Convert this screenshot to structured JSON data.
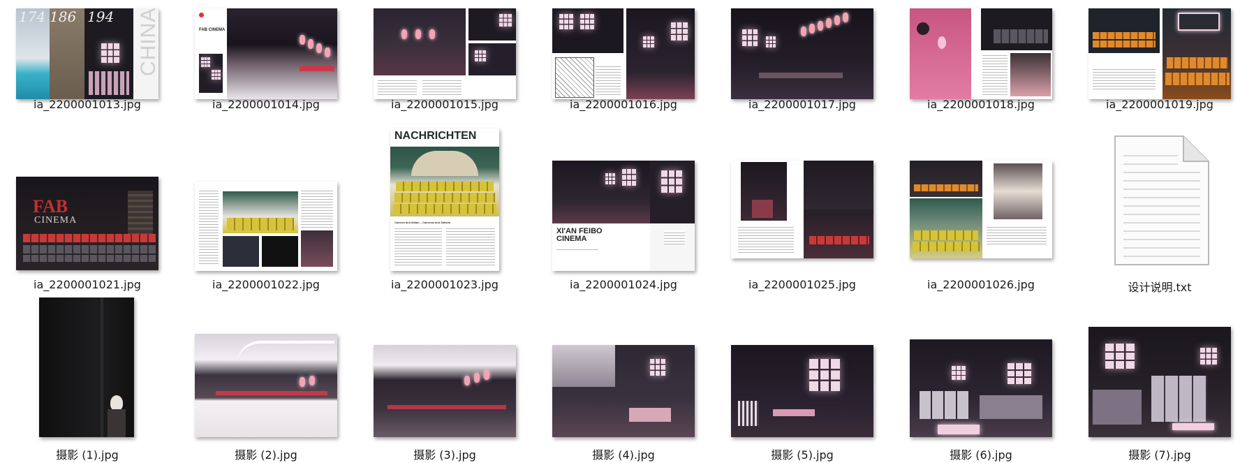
{
  "files": [
    {
      "name": "ia_2200001013.jpg",
      "icon": "image-thumbnail-icon",
      "cover_numbers": [
        "174",
        "186",
        "194"
      ],
      "cover_word": "CHINA"
    },
    {
      "name": "ia_2200001014.jpg",
      "icon": "image-thumbnail-icon",
      "page_heading": "FAB CINEMA"
    },
    {
      "name": "ia_2200001015.jpg",
      "icon": "image-thumbnail-icon"
    },
    {
      "name": "ia_2200001016.jpg",
      "icon": "image-thumbnail-icon"
    },
    {
      "name": "ia_2200001017.jpg",
      "icon": "image-thumbnail-icon"
    },
    {
      "name": "ia_2200001018.jpg",
      "icon": "image-thumbnail-icon"
    },
    {
      "name": "ia_2200001019.jpg",
      "icon": "image-thumbnail-icon"
    },
    {
      "name": "ia_2200001021.jpg",
      "icon": "image-thumbnail-icon",
      "title_top": "FAB",
      "title_bottom": "CINEMA"
    },
    {
      "name": "ia_2200001022.jpg",
      "icon": "image-thumbnail-icon"
    },
    {
      "name": "ia_2200001023.jpg",
      "icon": "image-thumbnail-icon",
      "headline": "NACHRICHTEN",
      "subhead": "Camera and Italian – Cameras and Saltwin"
    },
    {
      "name": "ia_2200001024.jpg",
      "icon": "image-thumbnail-icon",
      "title_top": "XI'AN FEIBO",
      "title_bottom": "CINEMA"
    },
    {
      "name": "ia_2200001025.jpg",
      "icon": "image-thumbnail-icon"
    },
    {
      "name": "ia_2200001026.jpg",
      "icon": "image-thumbnail-icon"
    },
    {
      "name": "设计说明.txt",
      "icon": "text-document-icon"
    },
    {
      "name": "摄影 (1).jpg",
      "icon": "image-thumbnail-icon"
    },
    {
      "name": "摄影 (2).jpg",
      "icon": "image-thumbnail-icon"
    },
    {
      "name": "摄影 (3).jpg",
      "icon": "image-thumbnail-icon"
    },
    {
      "name": "摄影 (4).jpg",
      "icon": "image-thumbnail-icon"
    },
    {
      "name": "摄影 (5).jpg",
      "icon": "image-thumbnail-icon"
    },
    {
      "name": "摄影 (6).jpg",
      "icon": "image-thumbnail-icon"
    },
    {
      "name": "摄影 (7).jpg",
      "icon": "image-thumbnail-icon"
    }
  ],
  "colors": {
    "background": "#ffffff",
    "label": "#1a1a1a",
    "accent_pink": "#d96f97",
    "accent_teal": "#2f5a4c"
  }
}
